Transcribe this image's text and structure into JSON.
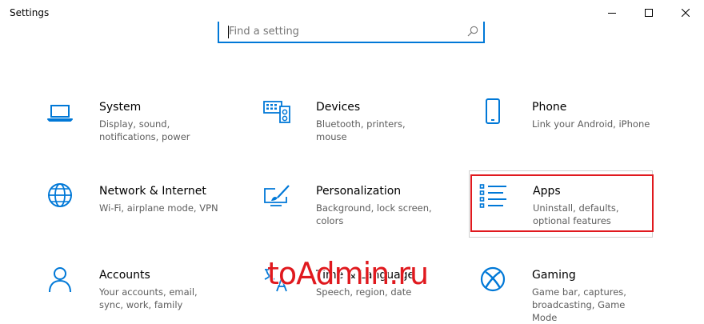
{
  "window": {
    "title": "Settings",
    "controls": [
      "minimize",
      "maximize",
      "close"
    ]
  },
  "search": {
    "placeholder": "Find a setting",
    "icon": "search-icon"
  },
  "tiles": [
    {
      "label": "System",
      "desc": "Display, sound, notifications, power",
      "icon": "laptop-icon"
    },
    {
      "label": "Devices",
      "desc": "Bluetooth, printers, mouse",
      "icon": "devices-icon"
    },
    {
      "label": "Phone",
      "desc": "Link your Android, iPhone",
      "icon": "phone-icon"
    },
    {
      "label": "Network & Internet",
      "desc": "Wi-Fi, airplane mode, VPN",
      "icon": "globe-icon"
    },
    {
      "label": "Personalization",
      "desc": "Background, lock screen, colors",
      "icon": "paint-icon"
    },
    {
      "label": "Apps",
      "desc": "Uninstall, defaults, optional features",
      "icon": "apps-list-icon",
      "highlighted": true
    },
    {
      "label": "Accounts",
      "desc": "Your accounts, email, sync, work, family",
      "icon": "person-icon"
    },
    {
      "label": "Time & Language",
      "desc": "Speech, region, date",
      "icon": "time-language-icon"
    },
    {
      "label": "Gaming",
      "desc": "Game bar, captures, broadcasting, Game Mode",
      "icon": "xbox-icon"
    }
  ],
  "watermark": "toAdmin.ru",
  "colors": {
    "accent": "#0078d7",
    "highlight": "#e0191e",
    "description": "#5d5d5d"
  }
}
